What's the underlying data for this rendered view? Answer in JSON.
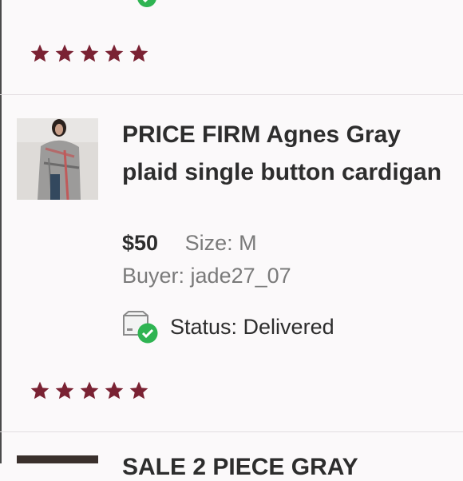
{
  "previous_item": {
    "rating": 5
  },
  "listing": {
    "title": "PRICE FIRM Agnes Gray plaid single button cardigan",
    "price": "$50",
    "size": "Size: M",
    "buyer": "Buyer: jade27_07",
    "status": "Status: Delivered",
    "rating": 5
  },
  "next_item": {
    "title_partial": "SALE 2 PIECE GRAY"
  },
  "colors": {
    "star": "#7a2233",
    "status_check": "#2fb452",
    "divider": "#e2dde0"
  },
  "icons": {
    "star": "star-icon",
    "status": "package-delivered-icon"
  }
}
